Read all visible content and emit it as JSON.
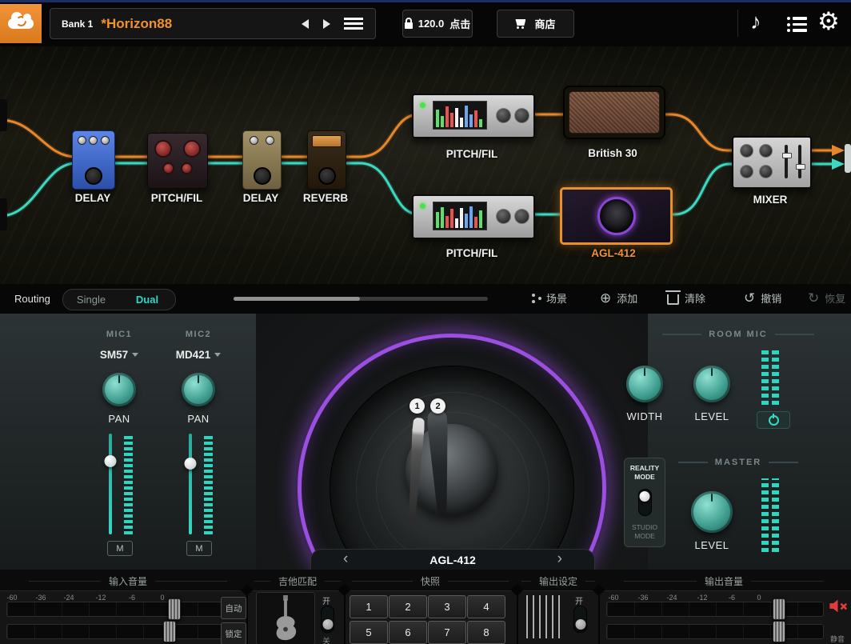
{
  "topbar": {
    "bank_label": "Bank 1",
    "preset_name": "*Horizon88",
    "bpm_value": "120.0",
    "tap_label": "点击",
    "store_label": "商店"
  },
  "icons": {
    "music": "♪",
    "gear": "⚙",
    "add": "⊕",
    "undo": "↺",
    "redo": "↻"
  },
  "chain": {
    "labels": [
      "DELAY",
      "PITCH/FIL",
      "DELAY",
      "REVERB",
      "PITCH/FIL",
      "British 30",
      "PITCH/FIL",
      "AGL-412",
      "MIXER"
    ]
  },
  "routing": {
    "title": "Routing",
    "single_label": "Single",
    "dual_label": "Dual",
    "scene_label": "场景",
    "add_label": "添加",
    "clear_label": "清除",
    "undo_label": "撤销",
    "redo_label": "恢复"
  },
  "stage": {
    "mic1_label": "MIC1",
    "mic1_value": "SM57",
    "mic2_label": "MIC2",
    "mic2_value": "MD421",
    "pan_label": "PAN",
    "mute_label": "M",
    "marker1": "1",
    "marker2": "2",
    "room_mic_title": "ROOM MIC",
    "width_label": "WIDTH",
    "level_label": "LEVEL",
    "reality_mode": "REALITY MODE",
    "studio_mode": "STUDIO MODE",
    "master_title": "MASTER",
    "master_level_label": "LEVEL",
    "cab_name": "AGL-412",
    "prev_arrow": "‹",
    "next_arrow": "›"
  },
  "bottom": {
    "input_title": "输入音量",
    "guitar_title": "吉他匹配",
    "snapshot_title": "快照",
    "output_settings_title": "输出设定",
    "output_title": "输出音量",
    "scale": [
      "-60",
      "-36",
      "-24",
      "-12",
      "-6",
      "0"
    ],
    "auto_label": "自动",
    "lock_label": "锁定",
    "on_label": "开",
    "off_label": "关",
    "snapshots": [
      "1",
      "2",
      "3",
      "4",
      "5",
      "6",
      "7",
      "8"
    ],
    "mute_label": "静音"
  }
}
